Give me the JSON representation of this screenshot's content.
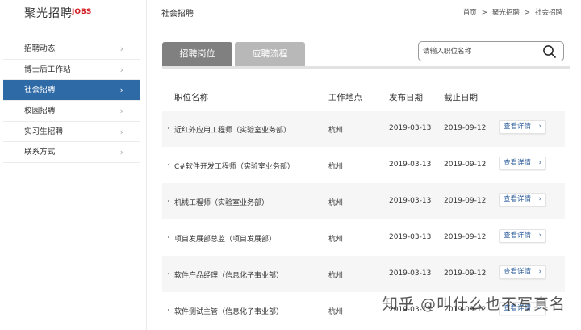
{
  "brand": {
    "name_cn": "聚光招聘",
    "name_en": "JOBS"
  },
  "sidebar": {
    "items": [
      {
        "label": "招聘动态",
        "active": false
      },
      {
        "label": "博士后工作站",
        "active": false
      },
      {
        "label": "社会招聘",
        "active": true
      },
      {
        "label": "校园招聘",
        "active": false
      },
      {
        "label": "实习生招聘",
        "active": false
      },
      {
        "label": "联系方式",
        "active": false
      }
    ]
  },
  "header": {
    "title": "社会招聘",
    "breadcrumb": [
      "首页",
      ">",
      "聚光招聘",
      ">",
      "社会招聘"
    ]
  },
  "tabs": [
    {
      "label": "招聘岗位"
    },
    {
      "label": "应聘流程"
    }
  ],
  "search": {
    "placeholder": "请输入职位名称"
  },
  "table": {
    "headers": [
      "职位名称",
      "工作地点",
      "发布日期",
      "截止日期"
    ],
    "detail_label": "查看详情",
    "rows": [
      {
        "name": "近红外应用工程师（实验室业务部）",
        "location": "杭州",
        "publish": "2019-03-13",
        "deadline": "2019-09-12"
      },
      {
        "name": "C#软件开发工程师（实验室业务部）",
        "location": "杭州",
        "publish": "2019-03-13",
        "deadline": "2019-09-12"
      },
      {
        "name": "机械工程师（实验室业务部）",
        "location": "杭州",
        "publish": "2019-03-13",
        "deadline": "2019-09-12"
      },
      {
        "name": "项目发展部总监（项目发展部）",
        "location": "杭州",
        "publish": "2019-03-13",
        "deadline": "2019-09-12"
      },
      {
        "name": "软件产品经理（信息化子事业部）",
        "location": "杭州",
        "publish": "2019-03-13",
        "deadline": "2019-09-12"
      },
      {
        "name": "软件测试主管（信息化子事业部）",
        "location": "杭州",
        "publish": "2019-03-13",
        "deadline": "2019-09-12"
      }
    ]
  },
  "watermark": "知乎 @叫什么也不写真名",
  "colors": {
    "accent": "#2d6aa6",
    "brand_red": "#d11f25",
    "tab_active": "#808080",
    "tab_inactive": "#b8b8b8",
    "link": "#2d5d9c"
  }
}
